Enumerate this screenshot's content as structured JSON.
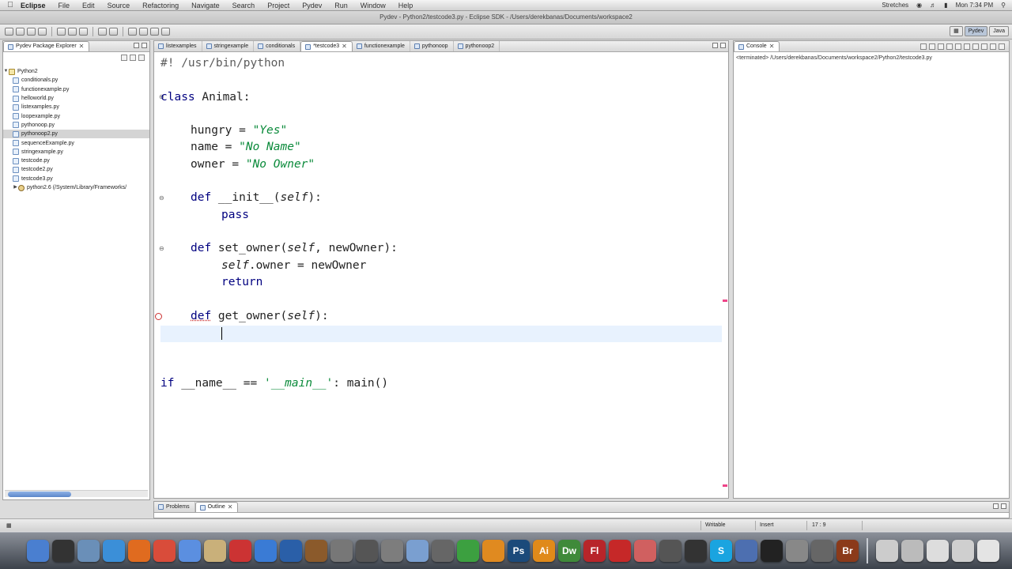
{
  "menubar": {
    "app": "Eclipse",
    "items": [
      "File",
      "Edit",
      "Source",
      "Refactoring",
      "Navigate",
      "Search",
      "Project",
      "Pydev",
      "Run",
      "Window",
      "Help"
    ],
    "window_title": "Pydev - Python2/testcode3.py - Eclipse SDK - /Users/derekbanas/Documents/workspace2",
    "clock": "Mon 7:34 PM",
    "status_item": "Stretches"
  },
  "perspectives": {
    "pydev": "Pydev",
    "java": "Java"
  },
  "package_explorer": {
    "title": "Pydev Package Explorer",
    "project": "Python2",
    "files": [
      "conditionals.py",
      "functionexample.py",
      "helloworld.py",
      "listexamples.py",
      "loopexample.py",
      "pythonoop.py",
      "pythonoop2.py",
      "sequenceExample.py",
      "stringexample.py",
      "testcode.py",
      "testcode2.py",
      "testcode3.py"
    ],
    "selected_index": 6,
    "library": "python2.6 (/System/Library/Frameworks/"
  },
  "editor": {
    "tabs": [
      "listexamples",
      "stringexample",
      "conditionals",
      "*testcode3",
      "functionexample",
      "pythonoop",
      "pythonoop2"
    ],
    "active_tab_index": 3
  },
  "code": {
    "l1": "#! /usr/bin/python",
    "class_kw": "class",
    "class_name": " Animal:",
    "hungry_a": "hungry = ",
    "hungry_v": "\"Yes\"",
    "name_a": "name = ",
    "name_v": "\"No Name\"",
    "owner_a": "owner = ",
    "owner_v": "\"No Owner\"",
    "def_kw": "def",
    "init_sig_a": " __init__(",
    "self_kw": "self",
    "init_sig_b": "):",
    "pass_kw": "pass",
    "set_sig_a": " set_owner(",
    "set_sig_b": ", newOwner):",
    "self_owner_b": ".owner = newOwner",
    "return_kw": "return",
    "get_sig_a": " get_owner(",
    "get_sig_b": "):",
    "if_kw": "if",
    "main_a": " __name__ == ",
    "main_str": "'__main__'",
    "main_b": ": main()"
  },
  "console": {
    "title": "Console",
    "path": "<terminated> /Users/derekbanas/Documents/workspace2/Python2/testcode3.py"
  },
  "bottom": {
    "problems": "Problems",
    "outline": "Outline"
  },
  "status": {
    "writable": "Writable",
    "insert": "Insert",
    "position": "17 : 9"
  },
  "dock": {
    "apps": [
      {
        "name": "finder",
        "label": "",
        "color": "#4a7fd0"
      },
      {
        "name": "dashboard",
        "label": "",
        "color": "#333333"
      },
      {
        "name": "preview",
        "label": "",
        "color": "#6a8fb8"
      },
      {
        "name": "safari",
        "label": "",
        "color": "#3b8fd8"
      },
      {
        "name": "firefox",
        "label": "",
        "color": "#e06b1f"
      },
      {
        "name": "chrome",
        "label": "",
        "color": "#d94c3a"
      },
      {
        "name": "ichat",
        "label": "",
        "color": "#5b8fe0"
      },
      {
        "name": "address-book",
        "label": "",
        "color": "#c9b07a"
      },
      {
        "name": "ical",
        "label": "",
        "color": "#cc3333"
      },
      {
        "name": "itunes",
        "label": "",
        "color": "#3a7bd5"
      },
      {
        "name": "quicktime",
        "label": "",
        "color": "#2a5fa8"
      },
      {
        "name": "photo",
        "label": "",
        "color": "#8b5a2b"
      },
      {
        "name": "automator",
        "label": "",
        "color": "#777777"
      },
      {
        "name": "expose",
        "label": "",
        "color": "#555555"
      },
      {
        "name": "system-prefs",
        "label": "",
        "color": "#7d7d7d"
      },
      {
        "name": "text-edit",
        "label": "",
        "color": "#7a9fd0"
      },
      {
        "name": "pen-tool",
        "label": "",
        "color": "#666666"
      },
      {
        "name": "numbers",
        "label": "",
        "color": "#3ca040"
      },
      {
        "name": "pages",
        "label": "",
        "color": "#e08a20"
      },
      {
        "name": "photoshop",
        "label": "Ps",
        "color": "#1b4a7a"
      },
      {
        "name": "illustrator",
        "label": "Ai",
        "color": "#e08a1a"
      },
      {
        "name": "dreamweaver",
        "label": "Dw",
        "color": "#3f8a3a"
      },
      {
        "name": "flash",
        "label": "Fl",
        "color": "#b8252a"
      },
      {
        "name": "acrobat",
        "label": "",
        "color": "#c62828"
      },
      {
        "name": "css-edit",
        "label": "",
        "color": "#d06060"
      },
      {
        "name": "camera",
        "label": "",
        "color": "#555555"
      },
      {
        "name": "clapper",
        "label": "",
        "color": "#333333"
      },
      {
        "name": "skype",
        "label": "S",
        "color": "#1aa4e0"
      },
      {
        "name": "network",
        "label": "",
        "color": "#4d6fb0"
      },
      {
        "name": "terminal",
        "label": "",
        "color": "#222222"
      },
      {
        "name": "calculator",
        "label": "",
        "color": "#888888"
      },
      {
        "name": "x-app",
        "label": "",
        "color": "#666666"
      },
      {
        "name": "bridge",
        "label": "Br",
        "color": "#8b3a1a"
      }
    ],
    "right_items": [
      {
        "name": "documents",
        "color": "#cccccc"
      },
      {
        "name": "stack",
        "color": "#bbbbbb"
      },
      {
        "name": "downloads",
        "color": "#dddddd"
      },
      {
        "name": "folder",
        "color": "#cfcfcf"
      },
      {
        "name": "trash",
        "color": "#e4e4e4"
      }
    ]
  }
}
